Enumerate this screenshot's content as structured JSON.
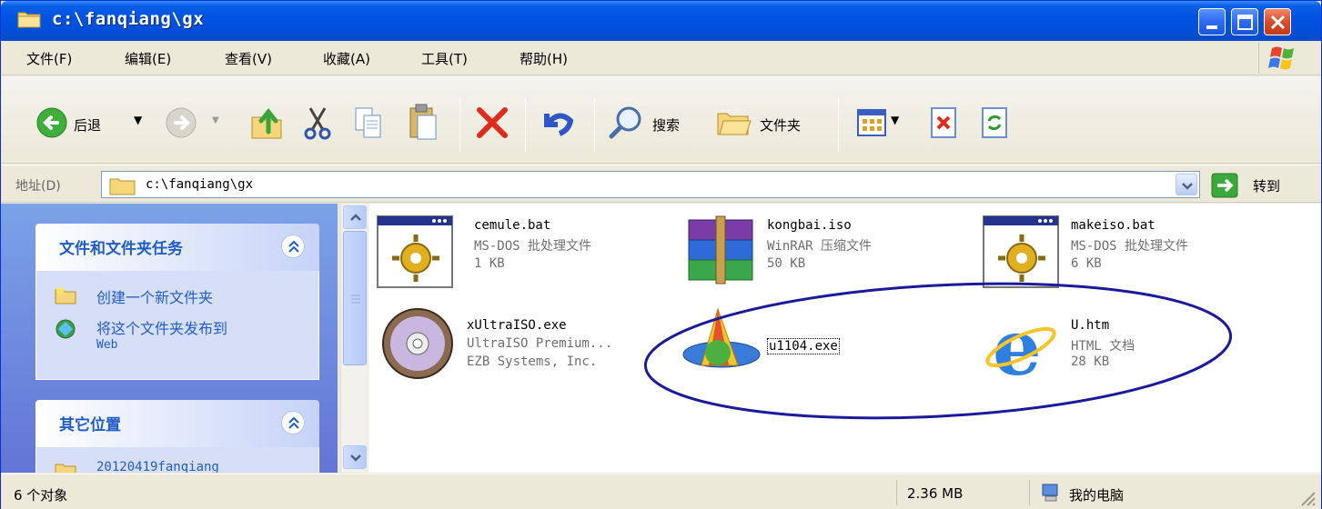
{
  "window": {
    "title": "c:\\fanqiang\\gx"
  },
  "menu": {
    "items": [
      "文件(F)",
      "编辑(E)",
      "查看(V)",
      "收藏(A)",
      "工具(T)",
      "帮助(H)"
    ]
  },
  "toolbar": {
    "back_label": "后退",
    "search_label": "搜索",
    "folders_label": "文件夹"
  },
  "address": {
    "label": "地址(D)",
    "value": "c:\\fanqiang\\gx",
    "go_label": "转到"
  },
  "taskpane": {
    "file_tasks": {
      "title": "文件和文件夹任务",
      "items": [
        {
          "label": "创建一个新文件夹",
          "icon": "new-folder-icon"
        },
        {
          "label": "将这个文件夹发布到",
          "sub": "Web",
          "icon": "publish-web-icon"
        }
      ]
    },
    "other_places": {
      "title": "其它位置",
      "partial_item": "20120419fanqiang"
    }
  },
  "files": [
    {
      "name": "cemule.bat",
      "type": "MS-DOS 批处理文件",
      "size": "1 KB",
      "icon": "batch-file-icon"
    },
    {
      "name": "kongbai.iso",
      "type": "WinRAR 压缩文件",
      "size": "50 KB",
      "icon": "winrar-archive-icon"
    },
    {
      "name": "makeiso.bat",
      "type": "MS-DOS 批处理文件",
      "size": "6 KB",
      "icon": "batch-file-icon"
    },
    {
      "name": "xUltraISO.exe",
      "type": "UltraISO Premium...",
      "size": "EZB Systems, Inc.",
      "icon": "ultraiso-disc-icon"
    },
    {
      "name": "u1104.exe",
      "type": "",
      "size": "",
      "icon": "ultrasurf-icon"
    },
    {
      "name": "U.htm",
      "type": "HTML 文档",
      "size": "28 KB",
      "icon": "internet-explorer-icon"
    }
  ],
  "status": {
    "objects": "6 个对象",
    "size": "2.36 MB",
    "location": "我的电脑"
  },
  "colors": {
    "titlebar": "#0053E1",
    "taskpane": "#6F8FDC",
    "task_link": "#215DC6",
    "highlight_ellipse": "#1A1A9A"
  }
}
